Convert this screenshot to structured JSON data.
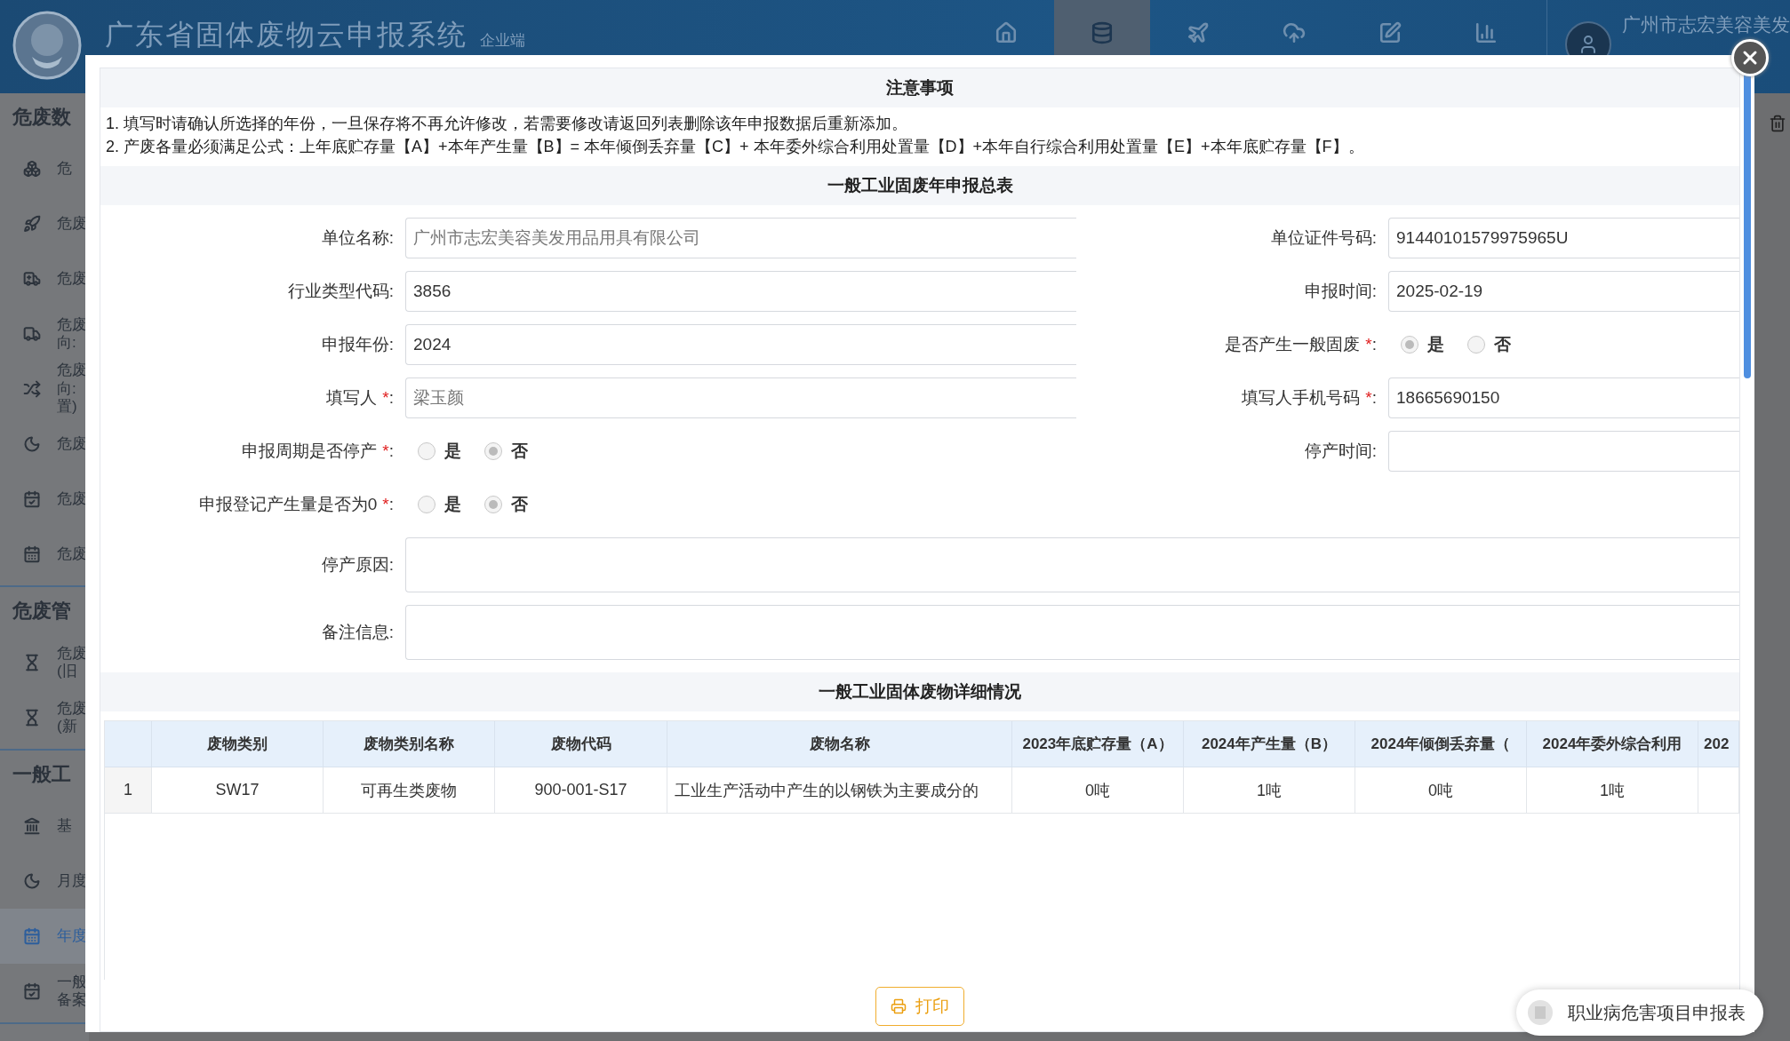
{
  "header": {
    "title": "广东省固体废物云申报系统",
    "subtitle": "企业端",
    "nav": [
      {
        "kind": "home",
        "selected": false
      },
      {
        "kind": "database",
        "selected": true
      },
      {
        "kind": "plane",
        "selected": false
      },
      {
        "kind": "cloud-upload",
        "selected": false
      },
      {
        "kind": "edit",
        "selected": false
      },
      {
        "kind": "chart",
        "selected": false
      }
    ],
    "user": "广州市志宏美容美发"
  },
  "sidebar": {
    "sections": [
      {
        "title": "危废数",
        "items": [
          {
            "kind": "cubes",
            "lines": [
              "危"
            ],
            "selected": false
          },
          {
            "kind": "rocket",
            "lines": [
              "危废"
            ],
            "selected": false
          },
          {
            "kind": "ambulance",
            "lines": [
              "危废"
            ],
            "selected": false
          },
          {
            "kind": "truck",
            "lines": [
              "危废",
              "向:"
            ],
            "selected": false
          },
          {
            "kind": "shuffle",
            "lines": [
              "危废",
              "向:",
              "置)"
            ],
            "selected": false
          },
          {
            "kind": "moon",
            "lines": [
              "危废"
            ],
            "selected": false
          },
          {
            "kind": "calendar-check",
            "lines": [
              "危废"
            ],
            "selected": false
          },
          {
            "kind": "calendar",
            "lines": [
              "危废"
            ],
            "selected": false
          }
        ]
      },
      {
        "title": "危废管",
        "items": [
          {
            "kind": "hourglass",
            "lines": [
              "危废",
              "(旧"
            ],
            "selected": false
          },
          {
            "kind": "hourglass",
            "lines": [
              "危废",
              "(新"
            ],
            "selected": false
          }
        ]
      },
      {
        "title": "一般工",
        "items": [
          {
            "kind": "bank",
            "lines": [
              "基"
            ],
            "selected": false
          },
          {
            "kind": "moon",
            "lines": [
              "月度"
            ],
            "selected": false
          },
          {
            "kind": "calendar",
            "lines": [
              "年度"
            ],
            "selected": true
          },
          {
            "kind": "calendar-check",
            "lines": [
              "一般",
              "备案"
            ],
            "selected": false
          }
        ]
      }
    ]
  },
  "dialog": {
    "notice": {
      "title": "注意事项",
      "lines": [
        "1. 填写时请确认所选择的年份，一旦保存将不再允许修改，若需要修改请返回列表删除该年申报数据后重新添加。",
        "2. 产废各量必须满足公式：上年底贮存量【A】+本年产生量【B】= 本年倾倒丢弃量【C】+ 本年委外综合利用处置量【D】+本年自行综合利用处置量【E】+本年底贮存量【F】。"
      ]
    },
    "summary": {
      "title": "一般工业固废年申报总表",
      "fields": [
        {
          "kind": "text",
          "label": "单位名称:",
          "value": "广州市志宏美容美发用品用具有限公司",
          "disabled": true
        },
        {
          "kind": "text",
          "label": "单位证件号码:",
          "value": "91440101579975965U",
          "disabled": false
        },
        {
          "kind": "text",
          "label": "行业类型代码:",
          "value": "3856",
          "disabled": false
        },
        {
          "kind": "text",
          "label": "申报时间:",
          "value": "2025-02-19",
          "disabled": false
        },
        {
          "kind": "text",
          "label": "申报年份:",
          "value": "2024",
          "disabled": false
        },
        {
          "kind": "radio",
          "label": "是否产生一般固废",
          "required_mark": "*",
          "colon": ":",
          "options": [
            {
              "label": "是",
              "selected": true
            },
            {
              "label": "否",
              "selected": false
            }
          ]
        },
        {
          "kind": "text",
          "label": "填写人",
          "required_mark": "*",
          "colon": ":",
          "value": "梁玉颜",
          "disabled": true
        },
        {
          "kind": "text",
          "label": "填写人手机号码",
          "required_mark": "*",
          "colon": ":",
          "value": "18665690150",
          "disabled": false
        },
        {
          "kind": "radio",
          "label": "申报周期是否停产",
          "required_mark": "*",
          "colon": ":",
          "options": [
            {
              "label": "是",
              "selected": false
            },
            {
              "label": "否",
              "selected": true
            }
          ]
        },
        {
          "kind": "text",
          "label": "停产时间:"
        },
        {
          "kind": "radio",
          "label": "申报登记产生量是否为0",
          "required_mark": "*",
          "colon": ":",
          "options": [
            {
              "label": "是",
              "selected": false
            },
            {
              "label": "否",
              "selected": true
            }
          ]
        },
        {
          "kind": "textarea",
          "label": "停产原因:"
        },
        {
          "kind": "textarea",
          "label": "备注信息:"
        }
      ]
    },
    "detail": {
      "title": "一般工业固体废物详细情况",
      "columns": [
        "",
        "废物类别",
        "废物类别名称",
        "废物代码",
        "废物名称",
        "2023年底贮存量（A）",
        "2024年产生量（B）",
        "2024年倾倒丢弃量（",
        "2024年委外综合利用",
        "202"
      ],
      "rows": [
        {
          "cells": [
            "1",
            "SW17",
            "可再生类废物",
            "900-001-S17",
            "工业生产活动中产生的以钢铁为主要成分的",
            "0吨",
            "1吨",
            "0吨",
            "1吨"
          ]
        }
      ]
    },
    "print_button": {
      "label": "打印"
    }
  },
  "float_button": {
    "label": "职业病危害项目申报表"
  }
}
